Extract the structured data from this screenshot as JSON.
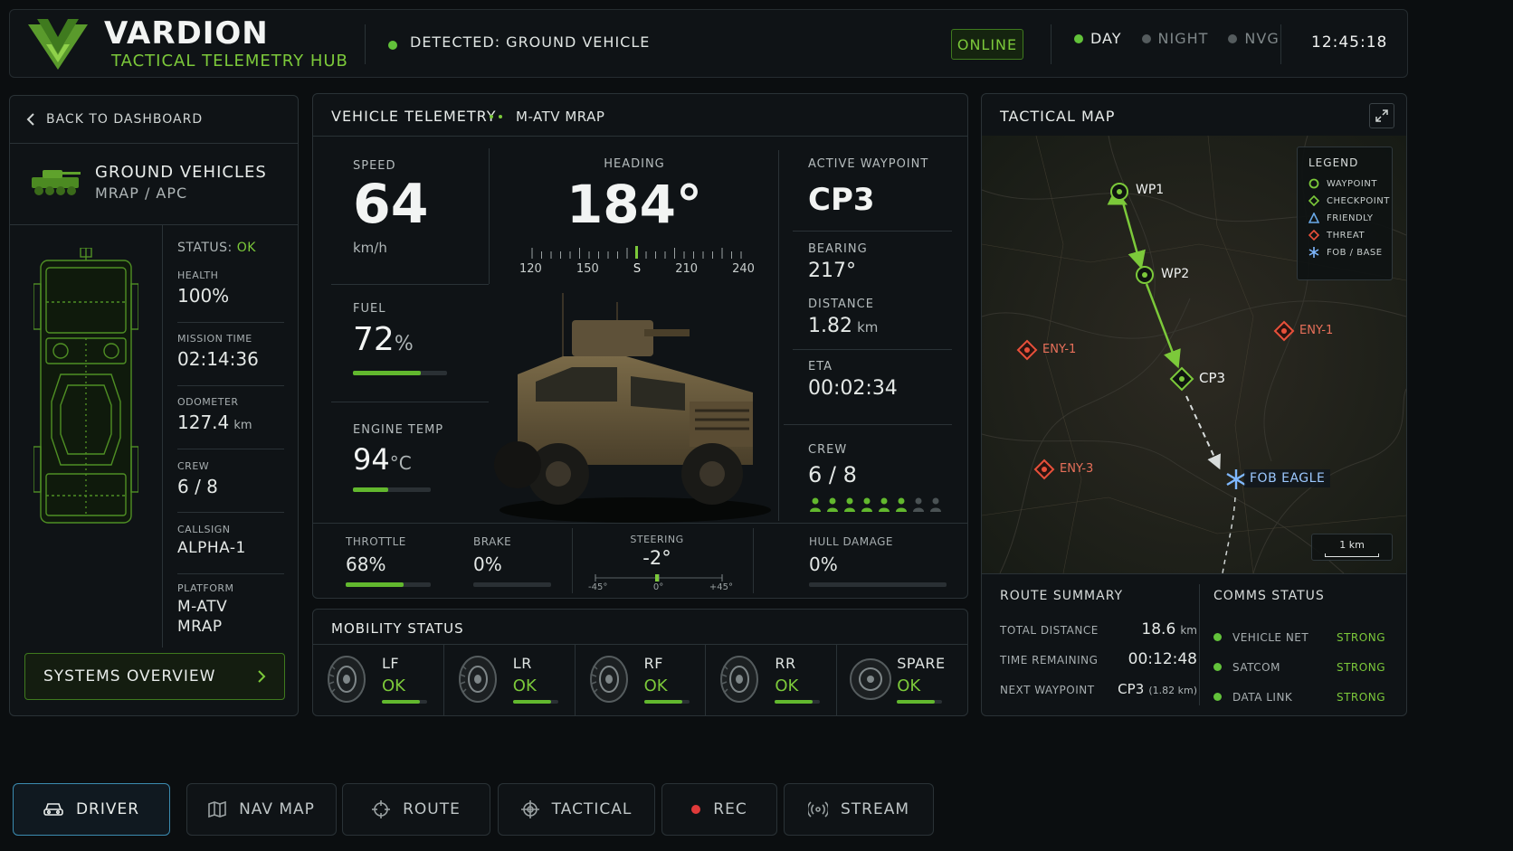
{
  "header": {
    "brand": "VARDION",
    "subtitle": "TACTICAL TELEMETRY HUB",
    "detected": "DETECTED: GROUND VEHICLE",
    "status_badge": "ONLINE",
    "modes": [
      "DAY",
      "NIGHT",
      "NVG"
    ],
    "active_mode": "DAY",
    "clock": "12:45:18"
  },
  "sidebar": {
    "back_label": "BACK TO DASHBOARD",
    "category_title": "GROUND VEHICLES",
    "category_sub": "MRAP / APC",
    "status_label": "STATUS:",
    "status_value": "OK",
    "stats": [
      {
        "label": "HEALTH",
        "value": "100%",
        "unit": ""
      },
      {
        "label": "MISSION TIME",
        "value": "02:14:36",
        "unit": ""
      },
      {
        "label": "ODOMETER",
        "value": "127.4",
        "unit": "km"
      },
      {
        "label": "CREW",
        "value": "6 / 8",
        "unit": ""
      },
      {
        "label": "CALLSIGN",
        "value": "ALPHA-1",
        "unit": ""
      },
      {
        "label": "PLATFORM",
        "value": "M-ATV",
        "value2": "MRAP",
        "unit": ""
      }
    ],
    "systems_button": "SYSTEMS OVERVIEW"
  },
  "telemetry": {
    "title": "VEHICLE TELEMETRY",
    "vehicle": "M-ATV MRAP",
    "speed_label": "SPEED",
    "speed_value": "64",
    "speed_unit": "km/h",
    "heading_label": "HEADING",
    "heading_value": "184°",
    "heading_ticks": [
      "120",
      "150",
      "S",
      "210",
      "240"
    ],
    "fuel_label": "FUEL",
    "fuel_value": "72",
    "fuel_unit": "%",
    "fuel_fraction": 0.72,
    "engine_label": "ENGINE TEMP",
    "engine_value": "94",
    "engine_unit": "°C",
    "engine_fraction": 0.45,
    "waypoint_label": "ACTIVE WAYPOINT",
    "waypoint_value": "CP3",
    "bearing_label": "BEARING",
    "bearing_value": "217°",
    "distance_label": "DISTANCE",
    "distance_value": "1.82",
    "distance_unit": "km",
    "eta_label": "ETA",
    "eta_value": "00:02:34",
    "crew_label": "CREW",
    "crew_value": "6 / 8",
    "crew_filled": 6,
    "crew_total": 8,
    "throttle_label": "THROTTLE",
    "throttle_value": "68%",
    "throttle_fraction": 0.68,
    "brake_label": "BRAKE",
    "brake_value": "0%",
    "steering_label": "STEERING",
    "steering_value": "-2°",
    "steering_ticks": [
      "-45°",
      "0°",
      "+45°"
    ],
    "hull_label": "HULL DAMAGE",
    "hull_value": "0%"
  },
  "mobility": {
    "title": "MOBILITY STATUS",
    "tires": [
      {
        "name": "LF",
        "status": "OK"
      },
      {
        "name": "LR",
        "status": "OK"
      },
      {
        "name": "RF",
        "status": "OK"
      },
      {
        "name": "RR",
        "status": "OK"
      },
      {
        "name": "SPARE",
        "status": "OK"
      }
    ]
  },
  "map": {
    "title": "TACTICAL MAP",
    "legend_title": "LEGEND",
    "legend": [
      "WAYPOINT",
      "CHECKPOINT",
      "FRIENDLY",
      "THREAT",
      "FOB / BASE"
    ],
    "markers": {
      "wp1": "WP1",
      "wp2": "WP2",
      "cp3": "CP3",
      "eny1a": "ENY-1",
      "eny1b": "ENY-1",
      "eny3": "ENY-3",
      "fob": "FOB EAGLE"
    },
    "scale": "1 km",
    "colors": {
      "waypoint": "#7cc93a",
      "checkpoint": "#7cc93a",
      "friendly": "#6aa9e8",
      "threat": "#e8503a",
      "fob": "#7fb8ff"
    }
  },
  "route": {
    "title": "ROUTE SUMMARY",
    "rows": [
      {
        "label": "TOTAL DISTANCE",
        "value": "18.6",
        "unit": "km"
      },
      {
        "label": "TIME REMAINING",
        "value": "00:12:48",
        "unit": ""
      },
      {
        "label": "NEXT WAYPOINT",
        "value": "CP3",
        "unit": "(1.82 km)"
      }
    ]
  },
  "comms": {
    "title": "COMMS STATUS",
    "rows": [
      {
        "label": "VEHICLE NET",
        "value": "STRONG"
      },
      {
        "label": "SATCOM",
        "value": "STRONG"
      },
      {
        "label": "DATA LINK",
        "value": "STRONG"
      }
    ]
  },
  "toolbar": {
    "buttons": [
      "DRIVER",
      "NAV MAP",
      "ROUTE",
      "TACTICAL",
      "REC",
      "STREAM"
    ],
    "active": "DRIVER"
  }
}
